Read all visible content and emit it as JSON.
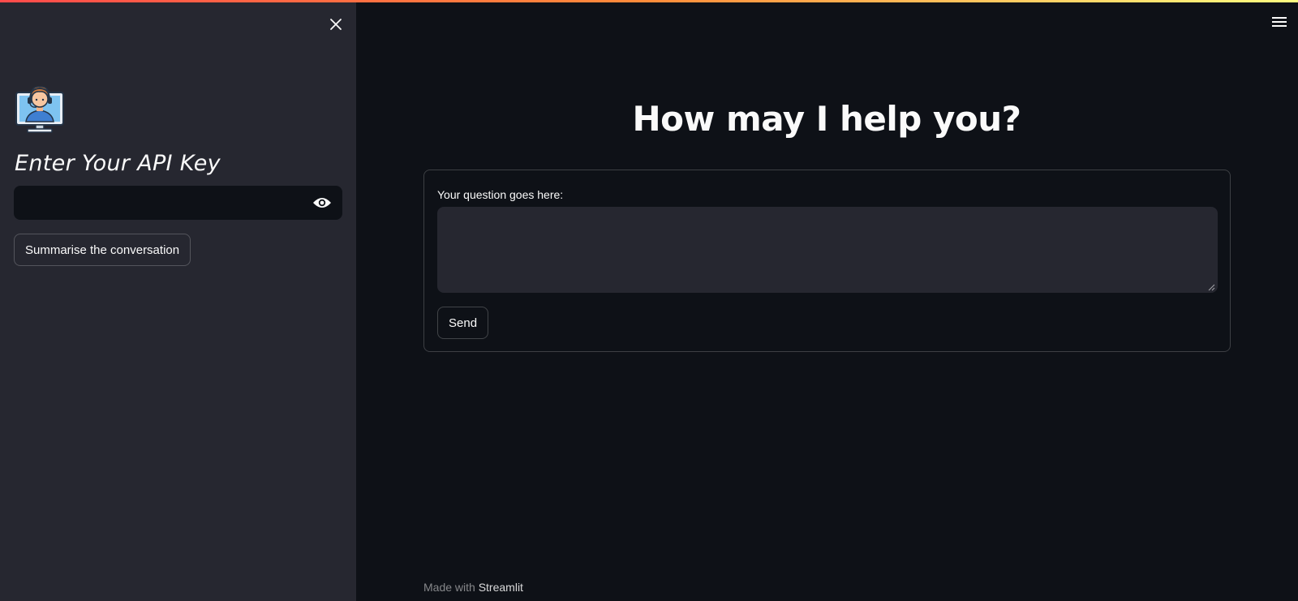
{
  "theme": {
    "accent_gradient": [
      "#ff4b4b",
      "#ff8c3a",
      "#fffd80"
    ],
    "sidebar_bg": "#262730",
    "main_bg": "#0e1117",
    "text": "#fafafa"
  },
  "sidebar": {
    "close_icon": "close-icon",
    "avatar_icon": "support-agent-monitor-icon",
    "title": "Enter Your API Key",
    "api_key": {
      "value": "",
      "placeholder": "",
      "toggle_icon": "eye-icon"
    },
    "summarise_button": "Summarise the conversation"
  },
  "header": {
    "menu_icon": "hamburger-menu-icon"
  },
  "main": {
    "title": "How may I help you?",
    "form": {
      "question_label": "Your question goes here:",
      "question_value": "",
      "question_placeholder": "",
      "send_button": "Send"
    }
  },
  "footer": {
    "prefix": "Made with",
    "brand": "Streamlit"
  }
}
